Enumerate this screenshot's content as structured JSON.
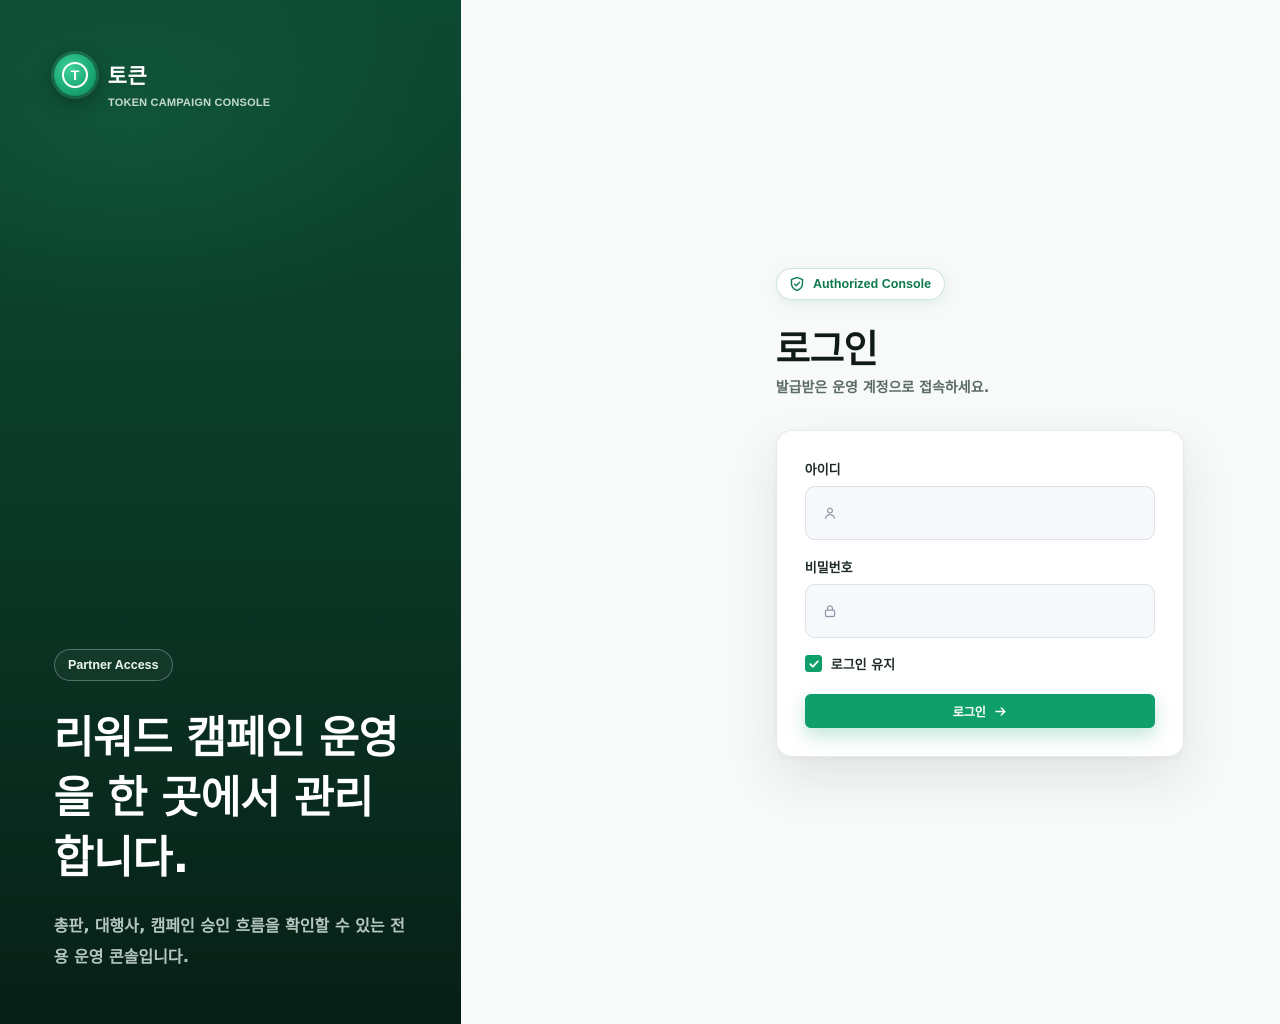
{
  "brand": {
    "logo_letter": "T",
    "name": "토큰",
    "subtitle": "TOKEN CAMPAIGN CONSOLE"
  },
  "hero": {
    "pill": "Partner Access",
    "title": "리워드 캠페인 운영을 한 곳에서 관리합니다.",
    "description": "총판, 대행사, 캠페인 승인 흐름을 확인할 수 있는 전용 운영 콘솔입니다."
  },
  "login": {
    "badge": "Authorized Console",
    "title": "로그인",
    "subtitle": "발급받은 운영 계정으로 접속하세요.",
    "id_label": "아이디",
    "id_value": "",
    "id_placeholder": "",
    "password_label": "비밀번호",
    "password_value": "",
    "password_placeholder": "",
    "remember_label": "로그인 유지",
    "remember_checked": true,
    "submit_label": "로그인"
  },
  "icons": {
    "badge": "shield-check-icon",
    "id_field": "user-icon",
    "password_field": "lock-icon",
    "remember": "check-icon",
    "submit": "arrow-right-icon"
  },
  "colors": {
    "brand_green": "#0e9f6b",
    "panel_dark": "#0b3a28",
    "badge_text": "#0e7a50"
  }
}
